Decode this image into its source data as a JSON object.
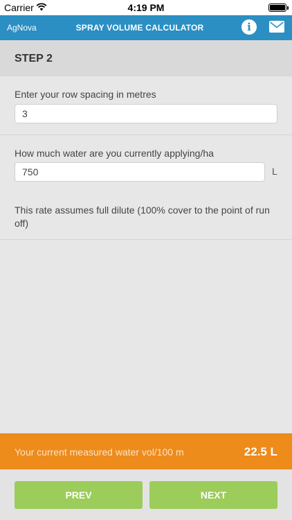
{
  "status_bar": {
    "carrier": "Carrier",
    "time": "4:19 PM"
  },
  "nav": {
    "brand": "AgNova",
    "title": "SPRAY VOLUME CALCULATOR",
    "info_icon": "info-icon",
    "mail_icon": "mail-icon",
    "accent_color": "#2b8fc3"
  },
  "step": {
    "title": "STEP 2"
  },
  "fields": {
    "row_spacing": {
      "label": "Enter your row spacing in metres",
      "value": "3"
    },
    "water_rate": {
      "label": "How much water are you currently applying/ha",
      "value": "750",
      "unit": "L"
    }
  },
  "note": "This rate assumes full dilute (100% cover to the point of run off)",
  "result": {
    "label": "Your current measured water vol/100 m",
    "value": "22.5 L",
    "color": "#ed8b1b"
  },
  "buttons": {
    "prev": "PREV",
    "next": "NEXT",
    "color": "#9ccc5a"
  }
}
